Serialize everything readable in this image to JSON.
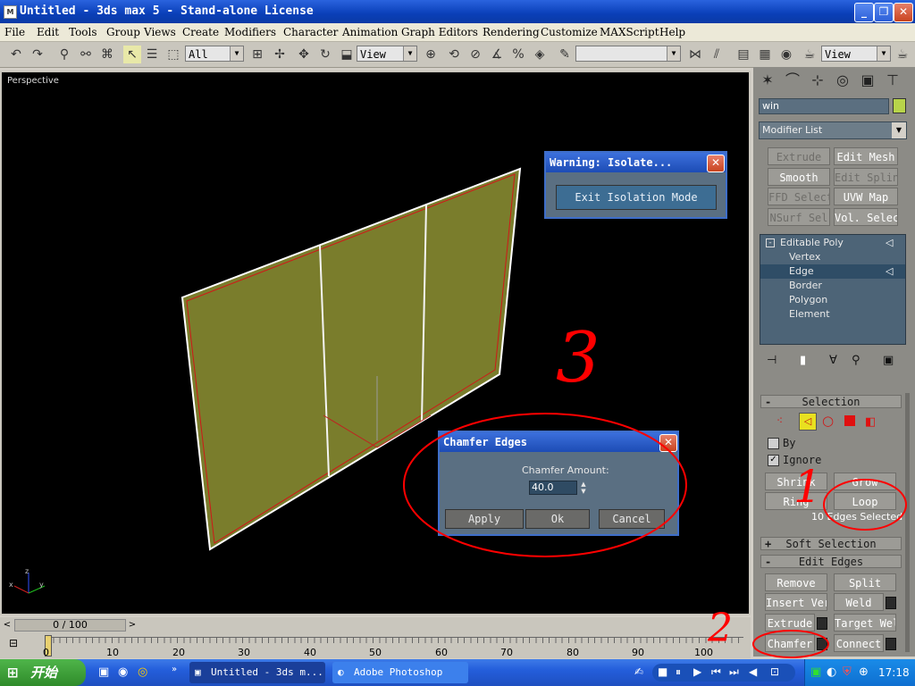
{
  "window": {
    "title": "Untitled - 3ds max 5 - Stand-alone License",
    "icon": "3dsmax-app-icon",
    "minimize": "_",
    "restore": "❐",
    "close": "✕"
  },
  "menu": [
    "File",
    "Edit",
    "Tools",
    "Group",
    "Views",
    "Create",
    "Modifiers",
    "Character",
    "Animation",
    "Graph Editors",
    "Rendering",
    "Customize",
    "MAXScript",
    "Help"
  ],
  "toolbar": {
    "selection_filter": "All",
    "ref_coord": "View",
    "named_selection": "",
    "render_type": "View"
  },
  "viewport": {
    "label": "Perspective",
    "axis_x": "x",
    "axis_y": "y",
    "axis_z": "z"
  },
  "panel": {
    "object_name": "win",
    "object_color": "#b8d44a",
    "modifier_list": "Modifier List",
    "modifier_buttons": [
      "Extrude",
      "Edit Mesh",
      "Smooth",
      "Edit Spline",
      "FFD Select",
      "UVW Map",
      "NSurf Sel",
      "Vol. Select"
    ],
    "stack": [
      {
        "label": "Editable Poly"
      },
      {
        "label": "Vertex"
      },
      {
        "label": "Edge"
      },
      {
        "label": "Border"
      },
      {
        "label": "Polygon"
      },
      {
        "label": "Element"
      }
    ],
    "selection_title": "Selection",
    "by_label": "By",
    "ignore_label": "Ignore",
    "ignore_checked": "✓",
    "shrink": "Shrink",
    "grow": "Grow",
    "ring": "Ring",
    "loop": "Loop",
    "selected_status": "10 Edges Selected",
    "soft_selection": "Soft Selection",
    "edit_edges": "Edit Edges",
    "remove": "Remove",
    "split": "Split",
    "insert_vertex": "Insert Vertex",
    "weld": "Weld",
    "extrude": "Extrude",
    "target_weld": "Target Weld",
    "chamfer": "Chamfer",
    "connect": "Connect",
    "plus": "+",
    "minus": "-"
  },
  "warning_dialog": {
    "title": "Warning: Isolate...",
    "button": "Exit Isolation Mode"
  },
  "chamfer_dialog": {
    "title": "Chamfer Edges",
    "amount_label": "Chamfer Amount:",
    "amount_value": "40.0",
    "apply": "Apply",
    "ok": "Ok",
    "cancel": "Cancel"
  },
  "timeline": {
    "frame_counter": "0 / 100",
    "ticks": [
      "0",
      "10",
      "20",
      "30",
      "40",
      "50",
      "60",
      "70",
      "80",
      "90",
      "100"
    ]
  },
  "annotations": {
    "one": "1",
    "two": "2",
    "three": "3"
  },
  "taskbar": {
    "start": "开始",
    "tasks": [
      "Untitled - 3ds m...",
      "Adobe Photoshop"
    ],
    "clock": "17:18"
  }
}
